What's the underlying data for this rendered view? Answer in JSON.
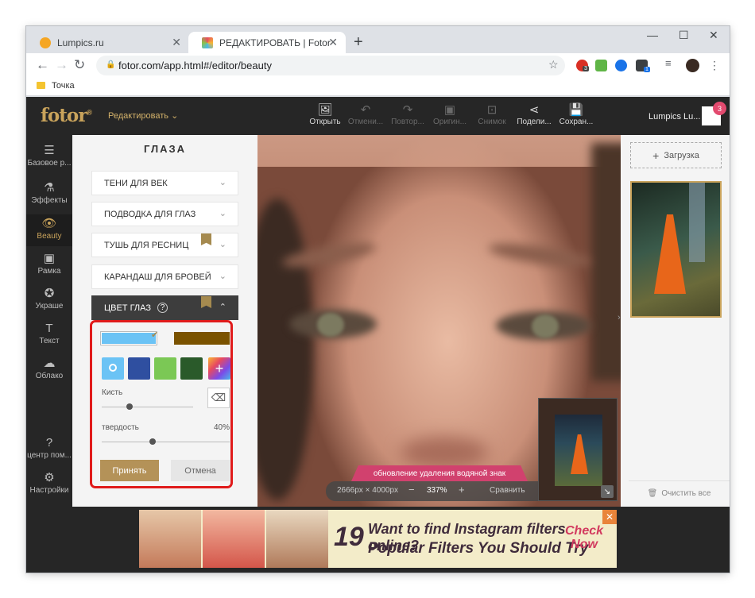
{
  "browser": {
    "tabs": [
      {
        "label": "Lumpics.ru"
      },
      {
        "label": "РЕДАКТИРОВАТЬ | Fotor"
      }
    ],
    "url": "fotor.com/app.html#/editor/beauty",
    "bookmark": "Точка",
    "ext_badges": [
      "3",
      "1"
    ]
  },
  "app": {
    "logo": "fotor",
    "logo_mark": "®",
    "edit_menu": "Редактировать",
    "tools": [
      {
        "label": "Открыть",
        "icon": "image-upload-icon"
      },
      {
        "label": "Отмени...",
        "icon": "undo-icon"
      },
      {
        "label": "Повтор...",
        "icon": "redo-icon"
      },
      {
        "label": "Оригин...",
        "icon": "original-icon"
      },
      {
        "label": "Снимок",
        "icon": "snapshot-icon"
      },
      {
        "label": "Подели...",
        "icon": "share-icon"
      },
      {
        "label": "Сохран...",
        "icon": "save-icon"
      }
    ],
    "user": "Lumpics Lu...",
    "notifications": "3"
  },
  "sidebar": {
    "items": [
      {
        "label": "Базовое р...",
        "icon": "sliders-icon"
      },
      {
        "label": "Эффекты",
        "icon": "flask-icon"
      },
      {
        "label": "Beauty",
        "icon": "eye-icon"
      },
      {
        "label": "Рамка",
        "icon": "frame-icon"
      },
      {
        "label": "Украше",
        "icon": "sticker-icon"
      },
      {
        "label": "Текст",
        "icon": "text-icon"
      },
      {
        "label": "Облако",
        "icon": "cloud-icon"
      },
      {
        "label": "центр пом...",
        "icon": "help-icon"
      },
      {
        "label": "Настройки",
        "icon": "gear-icon"
      }
    ]
  },
  "panel": {
    "title": "ГЛАЗА",
    "sections": [
      {
        "label": "ТЕНИ ДЛЯ ВЕК"
      },
      {
        "label": "ПОДВОДКА ДЛЯ ГЛАЗ"
      },
      {
        "label": "ТУШЬ ДЛЯ РЕСНИЦ"
      },
      {
        "label": "КАРАНДАШ ДЛЯ БРОВЕЙ"
      },
      {
        "label": "ЦВЕТ ГЛАЗ"
      }
    ],
    "brush_label": "Кисть",
    "hardness_label": "твердость",
    "hardness_value": "40%",
    "brush_size": 0.3,
    "hardness": 0.4,
    "accept": "Принять",
    "cancel": "Отмена",
    "colors": {
      "selected_a": "#6bc3f5",
      "selected_b": "#7a5200",
      "palette": [
        "#6bc3f5",
        "#2f4fa0",
        "#7bc855",
        "#2a5a2a"
      ]
    }
  },
  "canvas": {
    "watermark_banner": "обновление удаления водяной знак",
    "dimensions": "2666px × 4000px",
    "zoom": "337%",
    "compare": "Сравнить"
  },
  "right": {
    "upload": "Загрузка",
    "clear_all": "Очистить все"
  },
  "ad": {
    "number": "19",
    "line1": "Want to find Instagram filters online?",
    "line2": "Popular Filters You Should Try",
    "cta1": "Check",
    "cta2": "Now"
  }
}
